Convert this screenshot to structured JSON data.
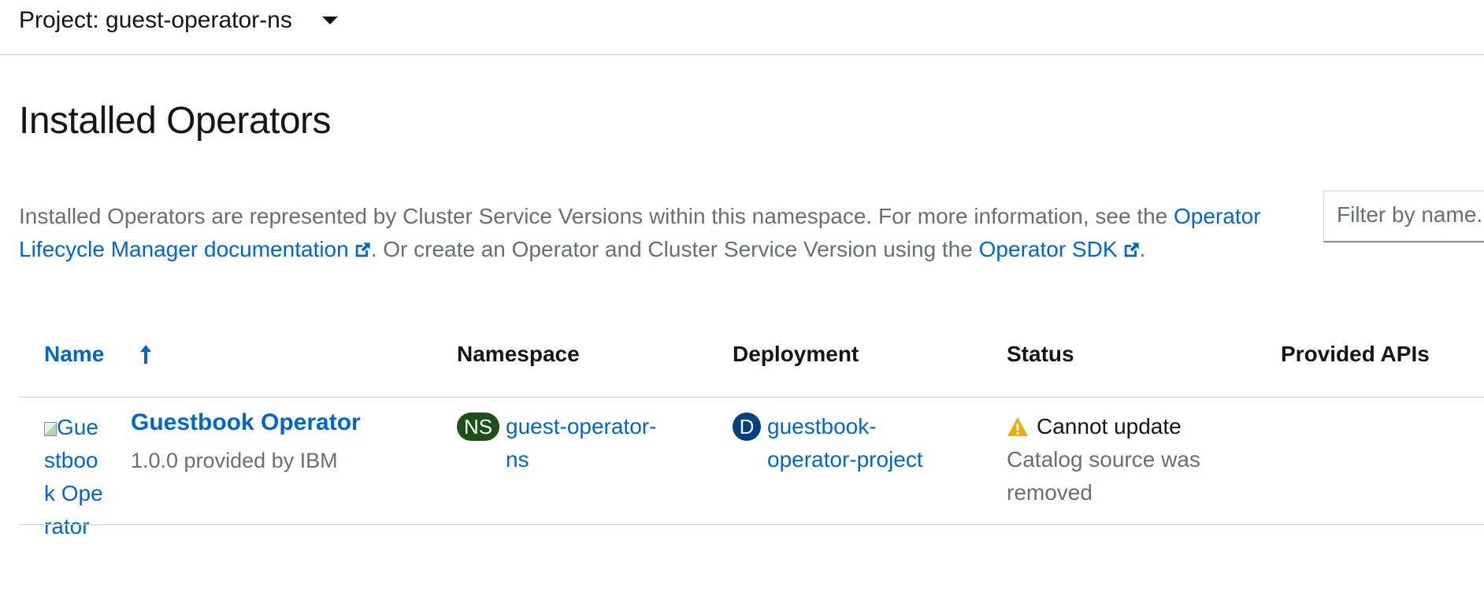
{
  "project_selector": {
    "label": "Project: guest-operator-ns",
    "caret_icon": "caret-down-icon"
  },
  "page": {
    "title": "Installed Operators"
  },
  "description": {
    "text_1": "Installed Operators are represented by Cluster Service Versions within this namespace. For more information, see the ",
    "link_olm": "Operator Lifecycle Manager documentation",
    "text_2": ". Or create an Operator and Cluster Service Version using the ",
    "link_sdk": "Operator SDK",
    "text_3": "."
  },
  "filter": {
    "placeholder": "Filter by name..."
  },
  "table": {
    "columns": [
      "Name",
      "Namespace",
      "Deployment",
      "Status",
      "Provided APIs"
    ],
    "sort_icon": "sort-ascending-icon",
    "rows": [
      {
        "logo_alt": "Guestbook Operator",
        "name": "Guestbook Operator",
        "subtitle": "1.0.0 provided by IBM",
        "namespace_badge": "NS",
        "namespace": "guest-operator-ns",
        "deployment_badge": "D",
        "deployment": "guestbook-operator-project",
        "status": "Cannot update",
        "status_detail": "Catalog source was removed",
        "status_icon": "warning-triangle-icon",
        "provided_apis": ""
      }
    ]
  },
  "colors": {
    "link": "#0066cc",
    "warning": "#f0ab00",
    "ns_badge": "#1e4f18",
    "deployment_badge": "#004080"
  }
}
